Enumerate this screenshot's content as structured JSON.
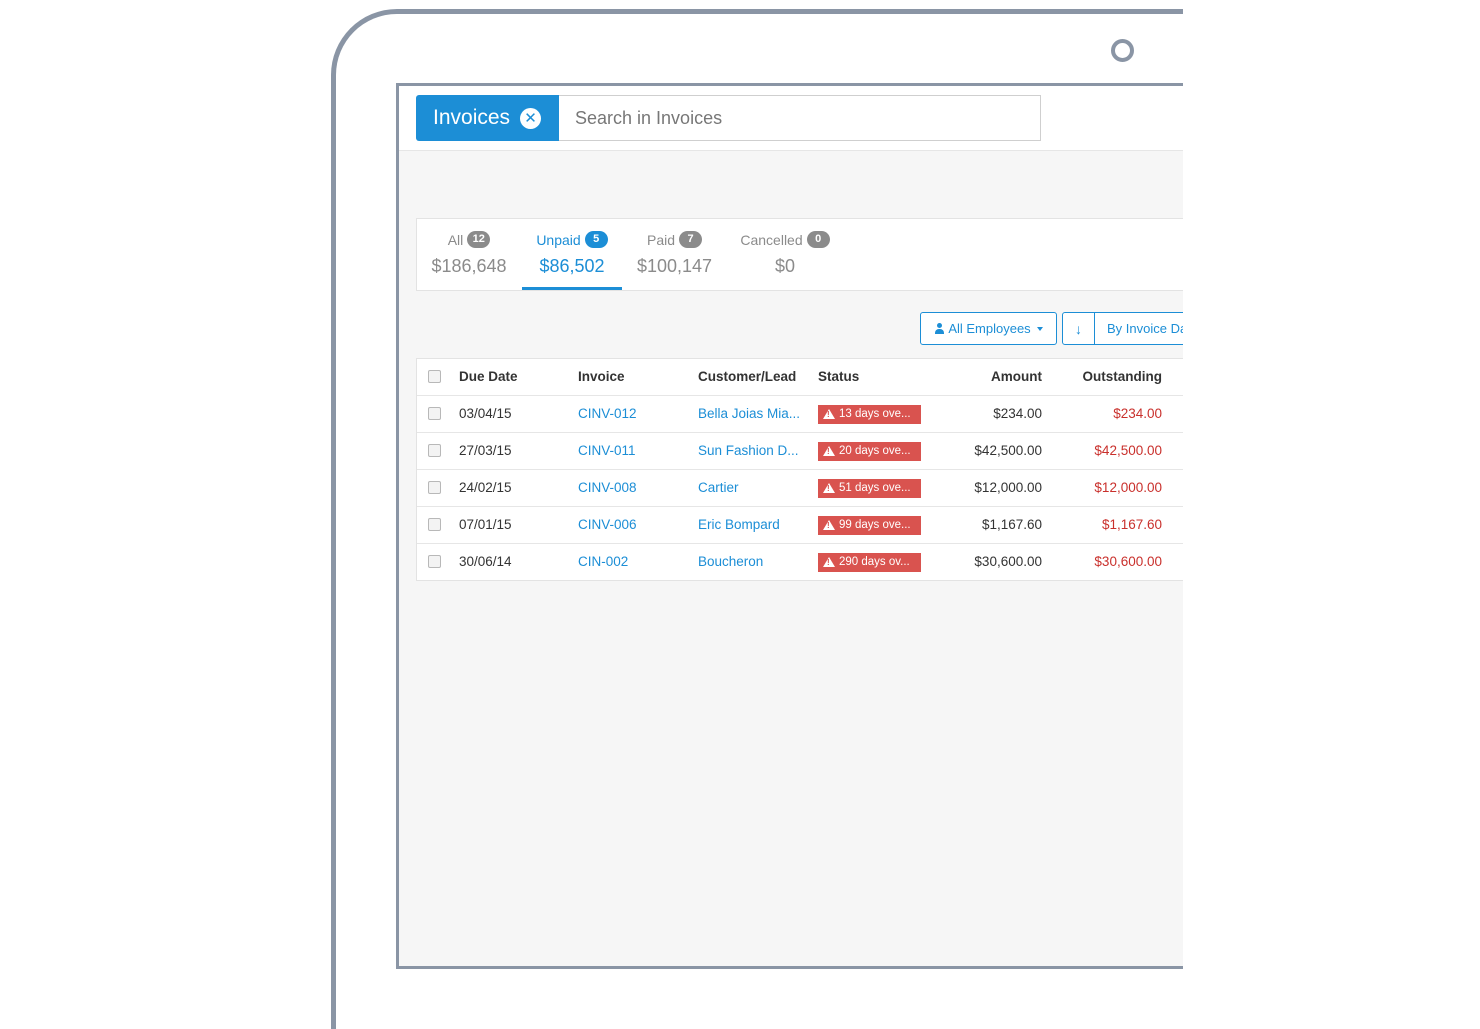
{
  "search": {
    "chip_label": "Invoices",
    "placeholder": "Search in Invoices"
  },
  "summary_tabs": [
    {
      "label": "All",
      "count": "12",
      "amount": "$186,648",
      "active": false
    },
    {
      "label": "Unpaid",
      "count": "5",
      "amount": "$86,502",
      "active": true
    },
    {
      "label": "Paid",
      "count": "7",
      "amount": "$100,147",
      "active": false
    },
    {
      "label": "Cancelled",
      "count": "0",
      "amount": "$0",
      "active": false
    }
  ],
  "toolbar": {
    "employees_label": "All Employees",
    "sort_direction": "↓",
    "sort_label": "By Invoice Date"
  },
  "table": {
    "headers": {
      "due_date": "Due Date",
      "invoice": "Invoice",
      "customer": "Customer/Lead",
      "status": "Status",
      "amount": "Amount",
      "outstanding": "Outstanding"
    },
    "rows": [
      {
        "due_date": "03/04/15",
        "invoice": "CINV-012",
        "customer": "Bella Joias Mia...",
        "status": "13 days ove...",
        "amount": "$234.00",
        "outstanding": "$234.00"
      },
      {
        "due_date": "27/03/15",
        "invoice": "CINV-011",
        "customer": "Sun Fashion D...",
        "status": "20 days ove...",
        "amount": "$42,500.00",
        "outstanding": "$42,500.00"
      },
      {
        "due_date": "24/02/15",
        "invoice": "CINV-008",
        "customer": "Cartier",
        "status": "51 days ove...",
        "amount": "$12,000.00",
        "outstanding": "$12,000.00"
      },
      {
        "due_date": "07/01/15",
        "invoice": "CINV-006",
        "customer": "Eric Bompard",
        "status": "99 days ove...",
        "amount": "$1,167.60",
        "outstanding": "$1,167.60"
      },
      {
        "due_date": "30/06/14",
        "invoice": "CIN-002",
        "customer": "Boucheron",
        "status": "290 days ov...",
        "amount": "$30,600.00",
        "outstanding": "$30,600.00"
      }
    ]
  },
  "colors": {
    "accent": "#1c8ed6",
    "overdue": "#d9534f",
    "outstanding_text": "#c9302c",
    "device_frame": "#8a95a5"
  }
}
